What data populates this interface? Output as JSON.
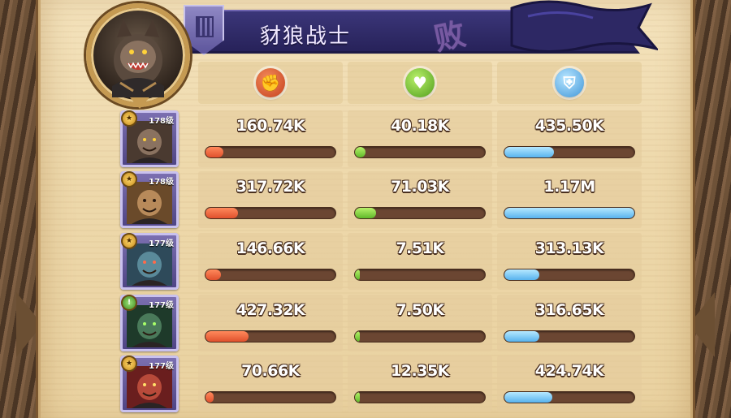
{
  "hero": {
    "name": "豺狼战士",
    "result_mark": "败"
  },
  "stat_icons": [
    {
      "kind": "damage",
      "icon": "fist-icon"
    },
    {
      "kind": "healing",
      "icon": "heal-heart-icon"
    },
    {
      "kind": "damage-taken",
      "icon": "shield-icon"
    }
  ],
  "rows": [
    {
      "level": "178级",
      "badge": "star",
      "portrait": "hyena-warrior",
      "damage": "160.74K",
      "damage_ratio": 0.14,
      "healing": "40.18K",
      "healing_ratio": 0.08,
      "taken": "435.50K",
      "taken_ratio": 0.38
    },
    {
      "level": "178级",
      "badge": "star",
      "portrait": "tan-warrior",
      "damage": "317.72K",
      "damage_ratio": 0.25,
      "healing": "71.03K",
      "healing_ratio": 0.16,
      "taken": "1.17M",
      "taken_ratio": 1.0
    },
    {
      "level": "177级",
      "badge": "star",
      "portrait": "blue-ogre",
      "damage": "146.66K",
      "damage_ratio": 0.12,
      "healing": "7.51K",
      "healing_ratio": 0.02,
      "taken": "313.13K",
      "taken_ratio": 0.27
    },
    {
      "level": "177级",
      "badge": "green",
      "portrait": "green-hooded",
      "damage": "427.32K",
      "damage_ratio": 0.33,
      "healing": "7.50K",
      "healing_ratio": 0.02,
      "taken": "316.65K",
      "taken_ratio": 0.27
    },
    {
      "level": "177级",
      "badge": "star",
      "portrait": "red-beast",
      "damage": "70.66K",
      "damage_ratio": 0.06,
      "healing": "12.35K",
      "healing_ratio": 0.03,
      "taken": "424.74K",
      "taken_ratio": 0.37
    }
  ],
  "colors": {
    "damage": "#e0502c",
    "healing": "#5fb82a",
    "taken": "#57b3ee",
    "banner": "#2f2a66"
  }
}
